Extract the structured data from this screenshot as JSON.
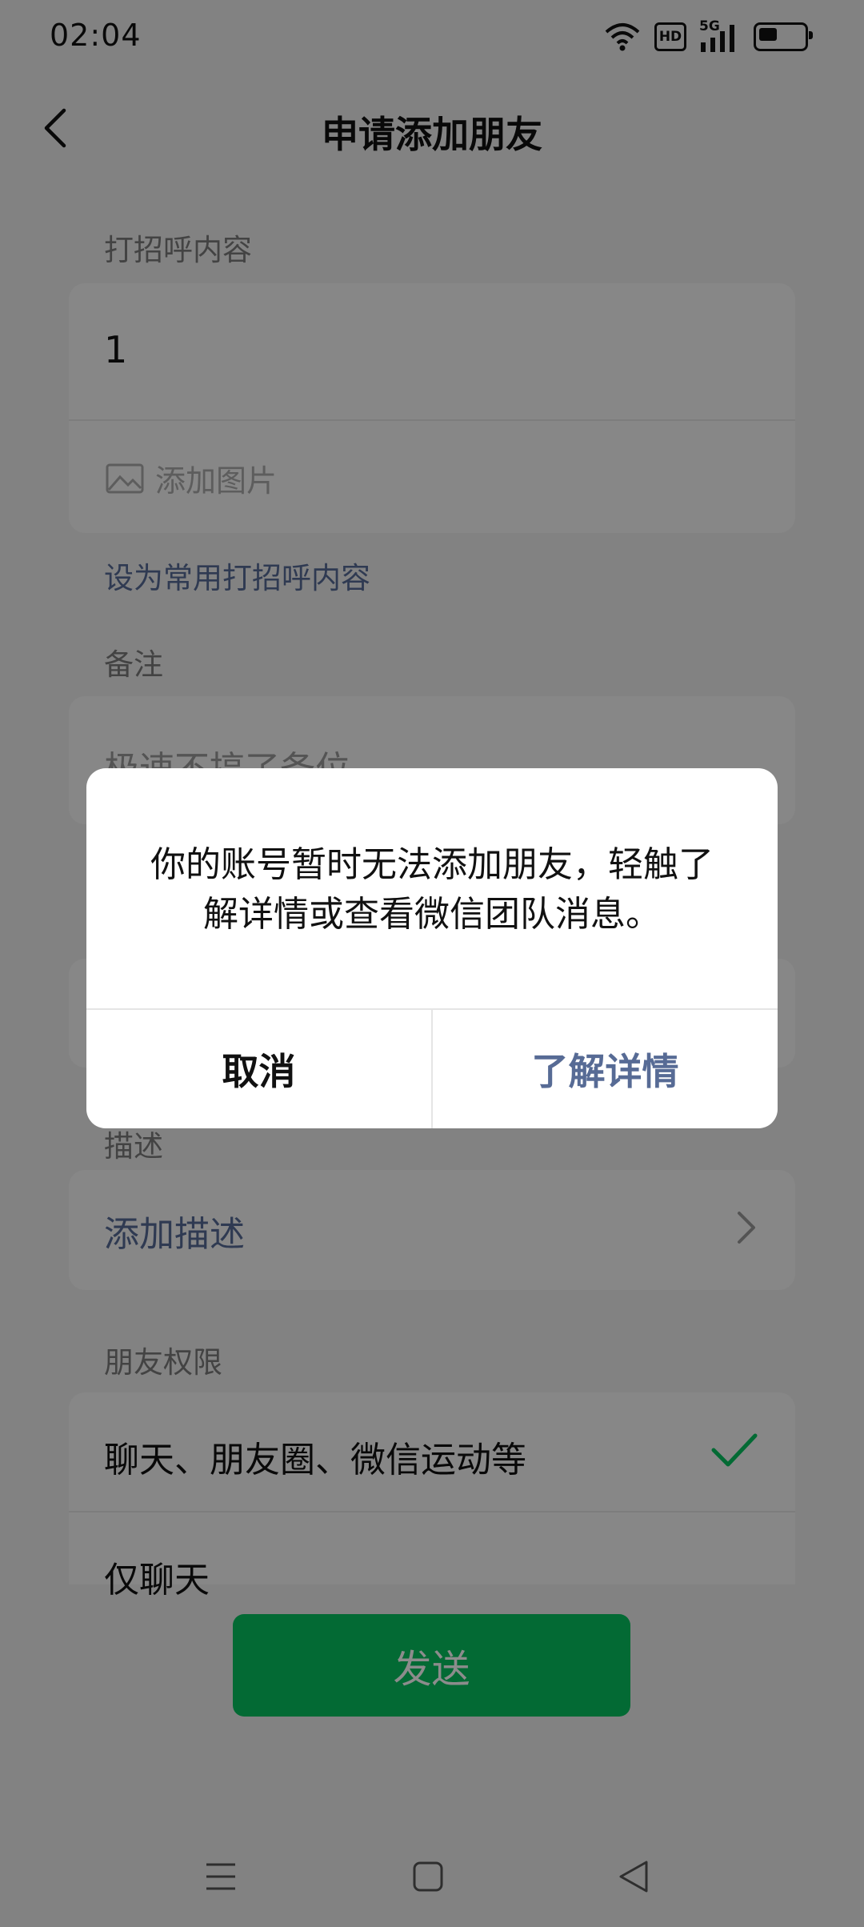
{
  "status_bar": {
    "time": "02:04",
    "network": "5G",
    "hd": "HD",
    "icons": [
      "wifi-icon",
      "hd-icon",
      "5g-signal-icon",
      "battery-icon"
    ]
  },
  "nav": {
    "title": "申请添加朋友",
    "back_icon": "chevron-left-icon"
  },
  "greeting": {
    "label": "打招呼内容",
    "value": "1",
    "add_image": "添加图片",
    "set_common": "设为常用打招呼内容"
  },
  "remark": {
    "label": "备注",
    "value": "极速不搞了备位"
  },
  "description": {
    "label": "描述",
    "add": "添加描述"
  },
  "permissions": {
    "label": "朋友权限",
    "option_all": "聊天、朋友圈、微信运动等",
    "option_chat": "仅聊天"
  },
  "send_button": "发送",
  "dialog": {
    "message": "你的账号暂时无法添加朋友，轻触了解详情或查看微信团队消息。",
    "cancel": "取消",
    "details": "了解详情"
  },
  "colors": {
    "accent_green": "#07c160",
    "link_blue": "#576b95"
  }
}
